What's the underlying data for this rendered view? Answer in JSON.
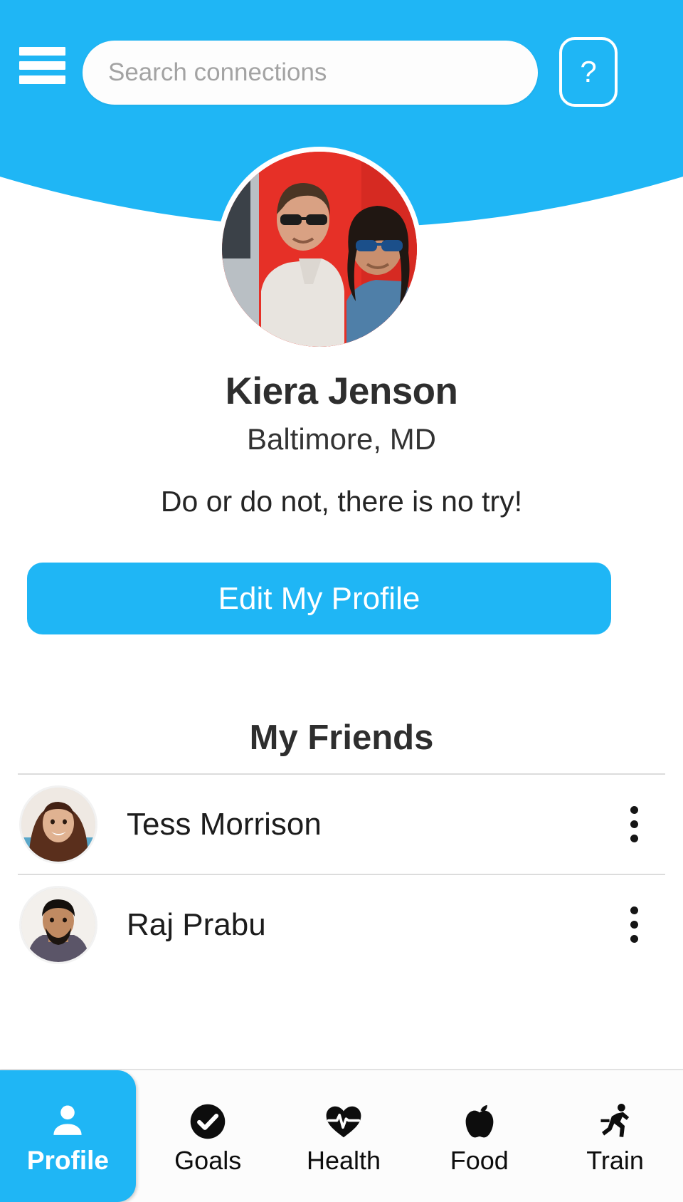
{
  "theme": {
    "accent": "#1FB6F5",
    "text_dark": "#2e2e2e",
    "nav_icon": "#0d0d0d",
    "divider": "#dcdcdc"
  },
  "header": {
    "menu_icon": "hamburger-menu-icon",
    "search": {
      "placeholder": "Search connections",
      "value": ""
    },
    "help_label": "?"
  },
  "profile": {
    "avatar_alt": "profile-photo-couple",
    "name": "Kiera Jenson",
    "location": "Baltimore, MD",
    "bio": "Do or do not, there is no try!",
    "edit_button_label": "Edit My Profile"
  },
  "friends": {
    "title": "My Friends",
    "items": [
      {
        "name": "Tess Morrison",
        "menu_icon": "more-vertical-icon"
      },
      {
        "name": "Raj Prabu",
        "menu_icon": "more-vertical-icon"
      }
    ]
  },
  "bottom_nav": {
    "items": [
      {
        "label": "Profile",
        "icon": "person-icon",
        "active": true
      },
      {
        "label": "Goals",
        "icon": "check-circle-icon",
        "active": false
      },
      {
        "label": "Health",
        "icon": "heart-pulse-icon",
        "active": false
      },
      {
        "label": "Food",
        "icon": "apple-icon",
        "active": false
      },
      {
        "label": "Train",
        "icon": "running-person-icon",
        "active": false
      }
    ]
  }
}
